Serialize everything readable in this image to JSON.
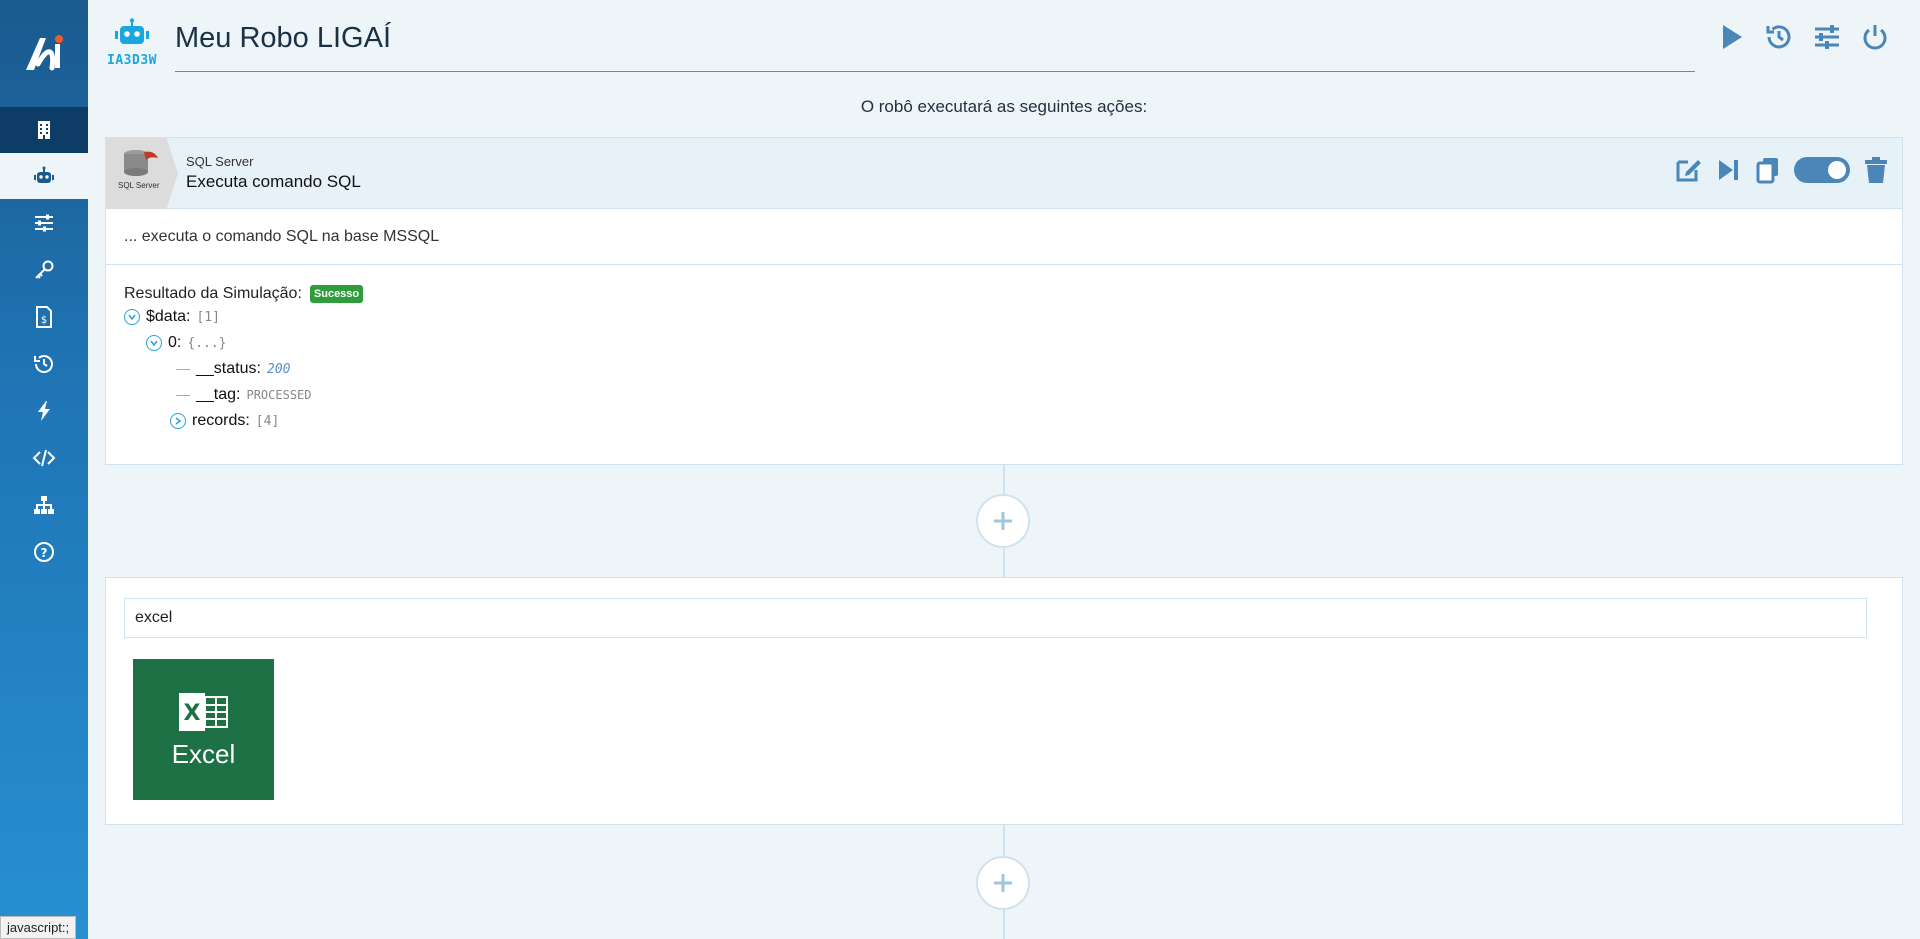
{
  "app": {
    "robot_code": "IA3D3W",
    "title": "Meu Robo LIGAÍ",
    "subtitle": "O robô executará as seguintes ações:"
  },
  "sidebar": {
    "items": [
      {
        "icon": "building-icon",
        "active": false
      },
      {
        "icon": "robot-icon",
        "active": true
      },
      {
        "icon": "sliders-icon",
        "active": false
      },
      {
        "icon": "key-icon",
        "active": false
      },
      {
        "icon": "invoice-icon",
        "active": false
      },
      {
        "icon": "history-icon",
        "active": false
      },
      {
        "icon": "bolt-icon",
        "active": false
      },
      {
        "icon": "code-icon",
        "active": false
      },
      {
        "icon": "network-icon",
        "active": false
      },
      {
        "icon": "help-icon",
        "active": false
      }
    ]
  },
  "header_actions": [
    "play-icon",
    "history-icon",
    "sliders-icon",
    "power-icon"
  ],
  "action_card": {
    "thumb_caption": "SQL Server",
    "kind": "SQL Server",
    "name": "Executa comando SQL",
    "description": "... executa o comando SQL na base MSSQL",
    "enabled": true,
    "simulation": {
      "title": "Resultado da Simulação:",
      "status": "Sucesso",
      "tree": {
        "data_key": "$data:",
        "data_count": "[1]",
        "item_key": "0:",
        "item_preview": "{...}",
        "status_key": "__status:",
        "status_value": "200",
        "tag_key": "__tag:",
        "tag_value": "PROCESSED",
        "records_key": "records:",
        "records_count": "[4]"
      }
    }
  },
  "search": {
    "value": "excel",
    "results": [
      {
        "label": "Excel",
        "color": "#1d7145"
      }
    ]
  },
  "status_bar": "javascript:;",
  "colors": {
    "accent": "#27a2dc",
    "sidebar_dark": "#0d3d66",
    "icon_blue": "#4a86b8",
    "success": "#2e9e3c"
  }
}
